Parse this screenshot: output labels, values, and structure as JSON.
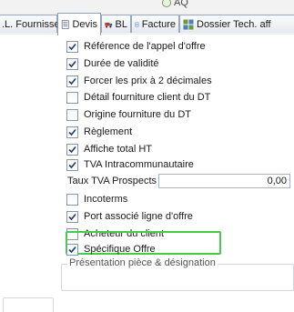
{
  "header": {
    "fragment_label": "AQ"
  },
  "tabs": [
    {
      "label": ".L. Fournisseur",
      "icon": "none"
    },
    {
      "label": "Devis",
      "icon": "document-icon"
    },
    {
      "label": "BL",
      "icon": "truck-icon"
    },
    {
      "label": "Facture",
      "icon": "invoice-icon"
    },
    {
      "label": "Dossier Tech. aff",
      "icon": "grid-icon"
    }
  ],
  "options": [
    {
      "label": "Référence de l'appel d'offre",
      "checked": true
    },
    {
      "label": "Durée de validité",
      "checked": true
    },
    {
      "label": "Forcer les prix à 2 décimales",
      "checked": true
    },
    {
      "label": "Détail fourniture client du DT",
      "checked": false
    },
    {
      "label": "Origine fourniture du DT",
      "checked": false
    },
    {
      "label": "Règlement",
      "checked": true
    },
    {
      "label": "Affiche total HT",
      "checked": true
    },
    {
      "label": "TVA Intracommunautaire",
      "checked": true
    }
  ],
  "tva_prospects": {
    "label": "Taux TVA Prospects",
    "value": "0,00"
  },
  "options_after": [
    {
      "label": "Incoterms",
      "checked": false
    },
    {
      "label": "Port associé ligne d'offre",
      "checked": true
    },
    {
      "label": "Acheteur du client",
      "checked": false
    },
    {
      "label": "Spécifique Offre",
      "checked": true
    }
  ],
  "group": {
    "title": "Présentation pièce & désignation"
  },
  "colors": {
    "highlight": "#48c84f",
    "border": "#a9b4c2"
  }
}
